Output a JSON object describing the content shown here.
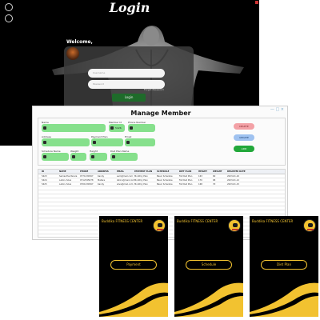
{
  "login": {
    "title": "Login",
    "welcome": "Welcome,",
    "username_placeholder": "Username",
    "password_placeholder": "Password",
    "forgot_label": "Forgot Password",
    "button_label": "Login"
  },
  "manage": {
    "title": "Manage Member",
    "window_controls": "— □ ×",
    "fields": {
      "name_label": "Name",
      "member_id_label": "Member Id",
      "member_id_value": "5426",
      "phone_label": "Phone Number",
      "address_label": "Address",
      "payment_plan_label": "Payment Plan",
      "email_label": "Email",
      "schedule_label": "Schedule Name",
      "weight_label": "Weight",
      "height_label": "Height",
      "diet_plan_label": "Diet Plan Name"
    },
    "buttons": {
      "delete": "DELETE",
      "update": "UPDATE",
      "add": "ADD"
    },
    "table": {
      "columns": [
        "ID",
        "NAME",
        "PHONE",
        "ADDRESS",
        "EMAIL",
        "PAYMENT PLAN",
        "SCHEDULE",
        "DIET PLAN",
        "HEIGHT",
        "WEIGHT",
        "REGISTER DATE"
      ],
      "rows": [
        [
          "5423",
          "Samantha Perera",
          "0771234567",
          "Kandy",
          "sam@mail.com",
          "Monthly Plan",
          "Basic Schedule",
          "Fat Diet Plan",
          "163",
          "60",
          "2023-01-10"
        ],
        [
          "5424",
          "Lahiru Silva",
          "0712345678",
          "Matara",
          "lahiru@mail.com",
          "Monthly Plan",
          "Basic Schedule",
          "Fat Diet Plan",
          "170",
          "68",
          "2023-01-12"
        ],
        [
          "5425",
          "Lahiru Silva",
          "0701234567",
          "Kandy",
          "silva@mail.com",
          "Monthly Plan",
          "Basic Schedule",
          "Fat Diet Plan",
          "168",
          "70",
          "2023-01-15"
        ]
      ]
    }
  },
  "cards": [
    {
      "brand": "Buddika FITNESS CENTER",
      "button": "Payment"
    },
    {
      "brand": "Buddika FITNESS CENTER",
      "button": "Schedule"
    },
    {
      "brand": "Buddika FITNESS CENTER",
      "button": "Diet Plan"
    }
  ],
  "colors": {
    "accent_yellow": "#f2c230",
    "field_green": "#86e08c",
    "delete_red": "#f3a1a6",
    "update_blue": "#9fc2f0",
    "add_green": "#22a83a",
    "login_button": "#1e6b2a"
  }
}
